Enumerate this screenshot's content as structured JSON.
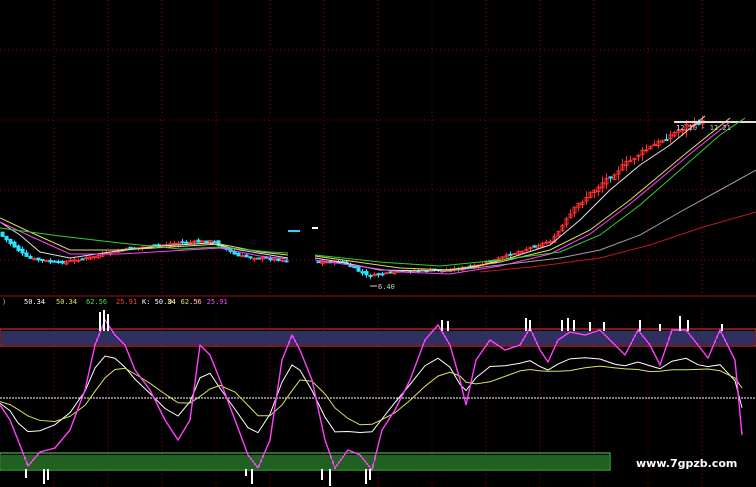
{
  "watermark": "www.7gpzb.com",
  "colors": {
    "background": "#000000",
    "grid": "#8b0000",
    "candle_up": "#ff3030",
    "candle_down": "#30e0ff",
    "ma_white": "#e0e0e0",
    "ma_yellow": "#e0e060",
    "ma_magenta": "#ff40ff",
    "ma_green": "#30d030",
    "ma_gray": "#a0a0a0",
    "ma_darkred": "#c01818",
    "band_top": "#6060c0",
    "band_bottom": "#40c040",
    "band_border": "#ff3030",
    "kdj_k": "#ffffff",
    "kdj_d": "#e0e060",
    "kdj_j": "#ff40ff"
  },
  "indicator_header": {
    "prefix": ")",
    "value1": "50.34",
    "value2": "50.34",
    "value3": "62.56",
    "value4": "25.91",
    "k_text": "K: 50.34",
    "d_text": "D: 62.56",
    "j_text": "J: 25.91"
  },
  "chart_data": [
    {
      "type": "candlestick",
      "annotations": [
        {
          "label": "6.40",
          "kind": "low"
        },
        {
          "label": "12.10 - 12.21",
          "kind": "high"
        }
      ],
      "price_range": [
        5.9,
        13.6
      ],
      "bars": 180,
      "grid": true
    },
    {
      "type": "line",
      "series": [
        {
          "name": "K",
          "last": 50.34
        },
        {
          "name": "D",
          "last": 62.56
        },
        {
          "name": "J",
          "last": 25.91
        }
      ],
      "ylim": [
        -10,
        110
      ],
      "reference_lines": [
        100,
        50,
        0
      ]
    }
  ]
}
